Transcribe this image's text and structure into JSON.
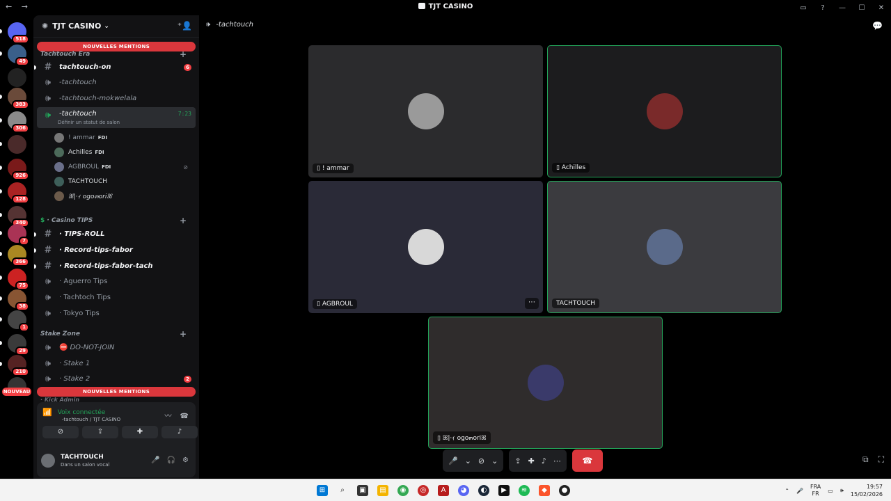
{
  "window": {
    "title": "TJT CASINO",
    "back": "←",
    "forward": "→"
  },
  "servers": [
    {
      "badge": "518",
      "color": "#5865f2"
    },
    {
      "badge": "49",
      "color": "#3a5f8a"
    },
    {
      "badge": "",
      "color": "#222"
    },
    {
      "badge": "383",
      "color": "#6a4a3a"
    },
    {
      "badge": "306",
      "color": "#8a8a8a"
    },
    {
      "badge": "",
      "color": "#4a2a2a"
    },
    {
      "badge": "926",
      "color": "#7a1a1a"
    },
    {
      "badge": "128",
      "color": "#aa2222"
    },
    {
      "badge": "340",
      "color": "#553333"
    },
    {
      "badge": "7",
      "color": "#aa3355"
    },
    {
      "badge": "366",
      "color": "#aa8822"
    },
    {
      "badge": "75",
      "color": "#cc2222"
    },
    {
      "badge": "38",
      "color": "#885533"
    },
    {
      "badge": "1",
      "color": "#444"
    },
    {
      "badge": "29",
      "color": "#3a3a3a"
    },
    {
      "badge": "210",
      "color": "#552222"
    },
    {
      "badge": "",
      "color": "#333"
    }
  ],
  "nouveau": "NOUVEAU",
  "guild": {
    "name": "TJT CASINO"
  },
  "mentions_label": "NOUVELLES MENTIONS",
  "categories": {
    "tachtouch": "Tachtouch Era",
    "casino_tips": "· Casino TIPS",
    "stake": "Stake Zone",
    "kick": "· Kick Admin"
  },
  "channels": {
    "tachtouch_on": {
      "label": "tachtouch-on",
      "badge": "6"
    },
    "tachtouch": {
      "label": "-tachtouch"
    },
    "mokwelala": {
      "label": "-tachtouch-mokwelala"
    },
    "active": {
      "label": "-tachtouch",
      "time": "7:23",
      "status": "Définir un statut de salon"
    },
    "tips_roll": {
      "label": "· TIPS-ROLL"
    },
    "record_fabor": {
      "label": "· Record-tips-fabor"
    },
    "record_tach": {
      "label": "· Record-tips-fabor-tach"
    },
    "aguerro": {
      "label": "· Aguerro Tips"
    },
    "tachtoch": {
      "label": "· Tachtoch Tips"
    },
    "tokyo": {
      "label": "· Tokyo Tips"
    },
    "donotjoin": {
      "label": "DO-NOT-JOIN"
    },
    "stake1": {
      "label": "· Stake 1"
    },
    "stake2": {
      "label": "· Stake 2",
      "badge": "2"
    }
  },
  "voice_users": [
    {
      "name": "! ammar",
      "tag": "FDI"
    },
    {
      "name": "Achilles",
      "tag": "FDI"
    },
    {
      "name": "AGBROUL",
      "tag": "FDI"
    },
    {
      "name": "TACHTOUCH",
      "tag": ""
    },
    {
      "name": "ꕤ|·ｨ ogo๓oriꕤ",
      "tag": ""
    }
  ],
  "voice_panel": {
    "status": "Voix connectée",
    "sub": "-tachtouch / TJT CASINO"
  },
  "user": {
    "name": "TACHTOUCH",
    "status": "Dans un salon vocal"
  },
  "main": {
    "channel": "-tachtouch"
  },
  "tiles": [
    {
      "name": "! ammar",
      "bg": "#2b2b2d"
    },
    {
      "name": "Achilles",
      "bg": "#1c1c1e"
    },
    {
      "name": "AGBROUL",
      "bg": "#2a2a37"
    },
    {
      "name": "TACHTOUCH",
      "bg": "#3b3b3f"
    },
    {
      "name": "ꕤ|·ｨ ogo๓oriꕤ",
      "bg": "#2f2c2c"
    }
  ],
  "taskbar": {
    "lang1": "FRA",
    "lang2": "FR",
    "time": "19:57",
    "date": "15/02/2026"
  }
}
